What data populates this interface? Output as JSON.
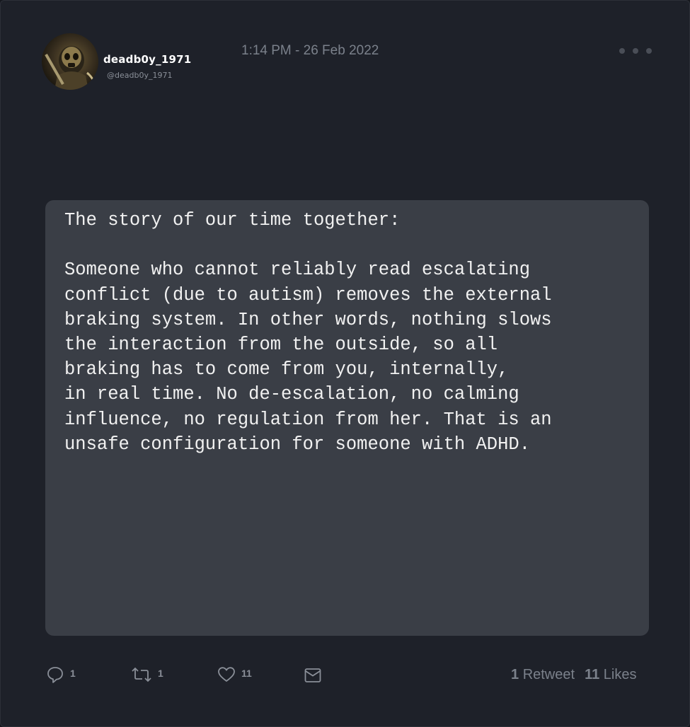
{
  "author": {
    "display_name": "deadb0y_1971",
    "handle": "@deadb0y_1971",
    "avatar_icon": "masked-figure-avatar"
  },
  "timestamp": "1:14 PM - 26 Feb 2022",
  "more_icon": "more-dots-icon",
  "post": {
    "lines": [
      "The story of our time together:",
      "",
      "Someone who cannot reliably read escalating",
      "conflict (due to autism) removes the external",
      "braking system. In other words, nothing slows",
      "the interaction from the outside, so all",
      "braking has to come from you, internally,",
      "in real time. No de-escalation, no calming",
      "influence, no regulation from her. That is an",
      "unsafe configuration for someone with ADHD."
    ]
  },
  "actions": {
    "reply": {
      "icon": "reply-icon",
      "count": "1"
    },
    "retweet": {
      "icon": "retweet-icon",
      "count": "1"
    },
    "like": {
      "icon": "heart-icon",
      "count": "11"
    },
    "message": {
      "icon": "envelope-icon"
    }
  },
  "stats": {
    "retweet_count": "1",
    "retweet_label": "Retweet",
    "like_count": "11",
    "like_label": "Likes"
  },
  "colors": {
    "background": "#1e2129",
    "panel": "#3a3e46",
    "muted_text": "#7b818b"
  }
}
